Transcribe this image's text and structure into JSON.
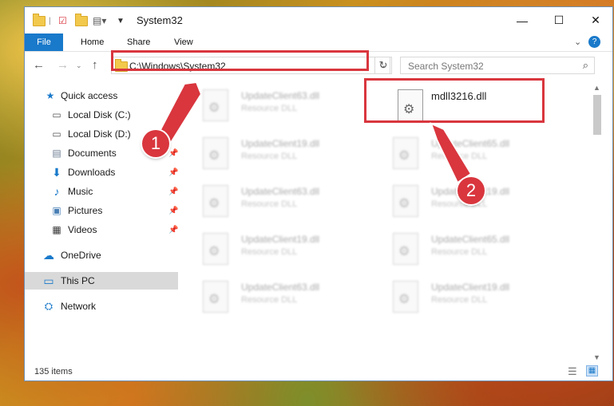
{
  "window": {
    "title": "System32"
  },
  "ribbon": {
    "tabs": [
      "File",
      "Home",
      "Share",
      "View"
    ]
  },
  "navigation": {
    "address": "C:\\Windows\\System32",
    "search_placeholder": "Search System32"
  },
  "sidebar": {
    "items": [
      {
        "label": "Quick access",
        "icon": "star-icon",
        "pinned": false
      },
      {
        "label": "Local Disk (C:)",
        "icon": "drive-icon",
        "pinned": false
      },
      {
        "label": "Local Disk (D:)",
        "icon": "drive-icon",
        "pinned": false
      },
      {
        "label": "Documents",
        "icon": "documents-icon",
        "pinned": true
      },
      {
        "label": "Downloads",
        "icon": "download-icon",
        "pinned": true
      },
      {
        "label": "Music",
        "icon": "music-icon",
        "pinned": true
      },
      {
        "label": "Pictures",
        "icon": "pictures-icon",
        "pinned": true
      },
      {
        "label": "Videos",
        "icon": "videos-icon",
        "pinned": true
      },
      {
        "label": "OneDrive",
        "icon": "cloud-icon",
        "pinned": false
      },
      {
        "label": "This PC",
        "icon": "computer-icon",
        "pinned": false,
        "selected": true
      },
      {
        "label": "Network",
        "icon": "network-icon",
        "pinned": false
      }
    ]
  },
  "files": [
    {
      "name": "UpdateClient63.dll",
      "type": "Resource DLL"
    },
    {
      "name": "mdll3216.dll",
      "type": ""
    },
    {
      "name": "UpdateClient19.dll",
      "type": "Resource DLL"
    },
    {
      "name": "UpdateClient65.dll",
      "type": "Resource DLL"
    },
    {
      "name": "UpdateClient63.dll",
      "type": "Resource DLL"
    },
    {
      "name": "UpdateClient19.dll",
      "type": "Resource DLL"
    },
    {
      "name": "UpdateClient19.dll",
      "type": "Resource DLL"
    },
    {
      "name": "UpdateClient65.dll",
      "type": "Resource DLL"
    },
    {
      "name": "UpdateClient63.dll",
      "type": "Resource DLL"
    },
    {
      "name": "UpdateClient19.dll",
      "type": "Resource DLL"
    }
  ],
  "status": {
    "item_count": "135 items"
  },
  "annotations": {
    "step1": "1",
    "step2": "2",
    "color": "#d9363e"
  }
}
